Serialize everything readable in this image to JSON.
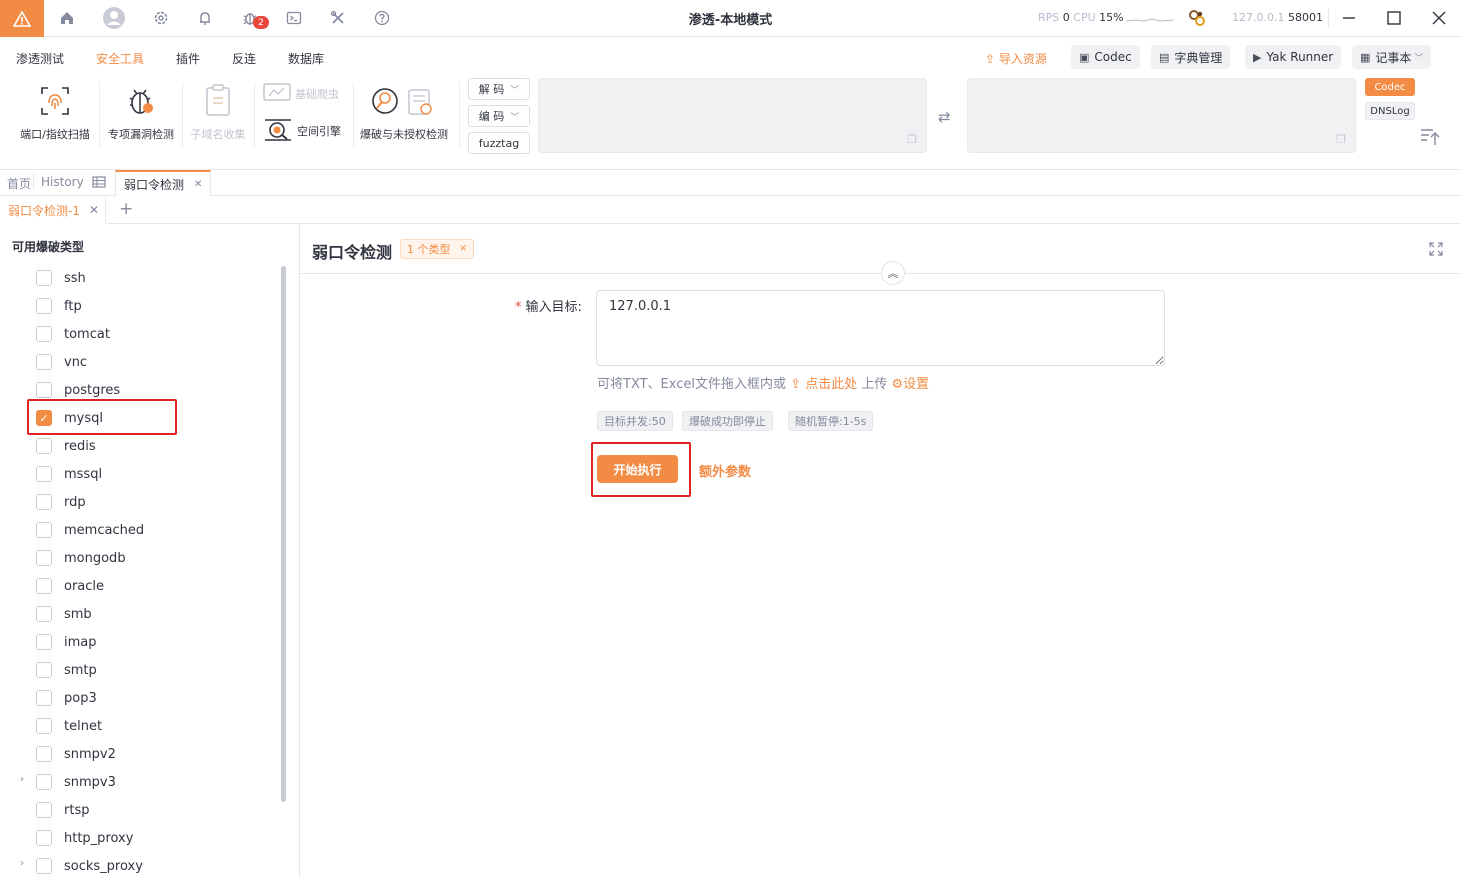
{
  "window": {
    "title": "渗透-本地模式",
    "badge_count": "2",
    "stats_rps_label": "RPS",
    "stats_rps": "0",
    "stats_cpu_label": "CPU",
    "stats_cpu": "15%",
    "engine_host": "127.0.0.1",
    "engine_port": "58001"
  },
  "menu": {
    "items": [
      "渗透测试",
      "安全工具",
      "插件",
      "反连",
      "数据库"
    ],
    "active": "安全工具",
    "import_label": "导入资源",
    "buttons": [
      "Codec",
      "字典管理",
      "Yak Runner",
      "记事本"
    ]
  },
  "toolbar": {
    "tools": [
      "端口/指纹扫描",
      "专项漏洞检测",
      "子域名收集",
      "基础爬虫",
      "空间引擎",
      "爆破与未授权检测"
    ],
    "decode_label": "解 码",
    "encode_label": "编 码",
    "fuzztag_label": "fuzztag",
    "side_codec": "Codec",
    "side_dnslog": "DNSLog"
  },
  "tabs": {
    "home": "首页",
    "history": "History",
    "active": "弱口令检测",
    "subtab": "弱口令检测-1"
  },
  "left_panel": {
    "heading": "可用爆破类型",
    "types": [
      "ssh",
      "ftp",
      "tomcat",
      "vnc",
      "postgres",
      "mysql",
      "redis",
      "mssql",
      "rdp",
      "memcached",
      "mongodb",
      "oracle",
      "smb",
      "imap",
      "smtp",
      "pop3",
      "telnet",
      "snmpv2",
      "snmpv3",
      "rtsp",
      "http_proxy",
      "socks_proxy"
    ],
    "checked": [
      "mysql"
    ]
  },
  "main": {
    "title": "弱口令检测",
    "type_tag": "1 个类型",
    "target_label": "输入目标:",
    "required_mark": "*",
    "target_value": "127.0.0.1",
    "hint_prefix": "可将TXT、Excel文件拖入框内或",
    "hint_link": "点击此处",
    "hint_suffix": "上传",
    "settings_label": "设置",
    "chips": [
      "目标并发:50",
      "爆破成功即停止",
      "随机暂停:1-5s"
    ],
    "start_button": "开始执行",
    "extra_params": "额外参数"
  },
  "colors": {
    "accent": "#f28b44",
    "highlight": "#e02424"
  }
}
